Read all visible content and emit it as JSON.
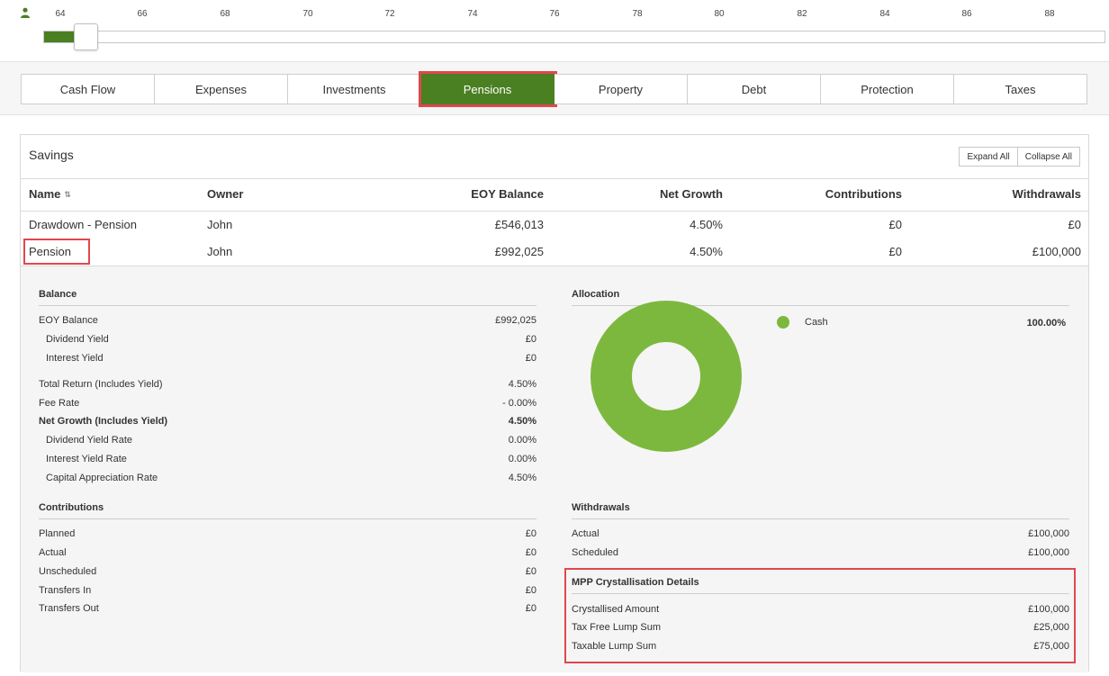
{
  "timeline": {
    "ages": [
      "64",
      "66",
      "68",
      "70",
      "72",
      "74",
      "76",
      "78",
      "80",
      "82",
      "84",
      "86",
      "88"
    ],
    "icon": "person-icon",
    "accent": "#4a7f22"
  },
  "tabs": [
    {
      "label": "Cash Flow",
      "active": false
    },
    {
      "label": "Expenses",
      "active": false
    },
    {
      "label": "Investments",
      "active": false
    },
    {
      "label": "Pensions",
      "active": true
    },
    {
      "label": "Property",
      "active": false
    },
    {
      "label": "Debt",
      "active": false
    },
    {
      "label": "Protection",
      "active": false
    },
    {
      "label": "Taxes",
      "active": false
    }
  ],
  "savings": {
    "title": "Savings",
    "expand_all": "Expand All",
    "collapse_all": "Collapse All",
    "columns": {
      "name": "Name",
      "owner": "Owner",
      "eoy_balance": "EOY Balance",
      "net_growth": "Net Growth",
      "contributions": "Contributions",
      "withdrawals": "Withdrawals"
    },
    "rows": [
      {
        "name": "Drawdown - Pension",
        "owner": "John",
        "eoy_balance": "£546,013",
        "net_growth": "4.50%",
        "contributions": "£0",
        "withdrawals": "£0"
      },
      {
        "name": "Pension",
        "owner": "John",
        "eoy_balance": "£992,025",
        "net_growth": "4.50%",
        "contributions": "£0",
        "withdrawals": "£100,000"
      }
    ]
  },
  "detail": {
    "balance": {
      "title": "Balance",
      "rows": [
        {
          "label": "EOY Balance",
          "value": "£992,025"
        },
        {
          "label": "Dividend Yield",
          "value": "£0"
        },
        {
          "label": "Interest Yield",
          "value": "£0"
        },
        {
          "label": "Total Return (Includes Yield)",
          "value": "4.50%"
        },
        {
          "label": "Fee Rate",
          "value": "- 0.00%"
        },
        {
          "label": "Net Growth (Includes Yield)",
          "value": "4.50%"
        },
        {
          "label": "Dividend Yield Rate",
          "value": "0.00%"
        },
        {
          "label": "Interest Yield Rate",
          "value": "0.00%"
        },
        {
          "label": "Capital Appreciation Rate",
          "value": "4.50%"
        }
      ]
    },
    "allocation": {
      "title": "Allocation",
      "items": [
        {
          "label": "Cash",
          "value": "100.00%",
          "color": "#7cb83e"
        }
      ]
    },
    "contributions": {
      "title": "Contributions",
      "rows": [
        {
          "label": "Planned",
          "value": "£0"
        },
        {
          "label": "Actual",
          "value": "£0"
        },
        {
          "label": "Unscheduled",
          "value": "£0"
        },
        {
          "label": "Transfers In",
          "value": "£0"
        },
        {
          "label": "Transfers Out",
          "value": "£0"
        }
      ]
    },
    "withdrawals": {
      "title": "Withdrawals",
      "rows": [
        {
          "label": "Actual",
          "value": "£100,000"
        },
        {
          "label": "Scheduled",
          "value": "£100,000"
        }
      ]
    },
    "mpp": {
      "title": "MPP Crystallisation Details",
      "rows": [
        {
          "label": "Crystallised Amount",
          "value": "£100,000"
        },
        {
          "label": "Tax Free Lump Sum",
          "value": "£25,000"
        },
        {
          "label": "Taxable Lump Sum",
          "value": "£75,000"
        }
      ]
    }
  },
  "colors": {
    "highlight": "#e0474c",
    "donut": "#7cb83e",
    "active_tab": "#4a7f22"
  }
}
